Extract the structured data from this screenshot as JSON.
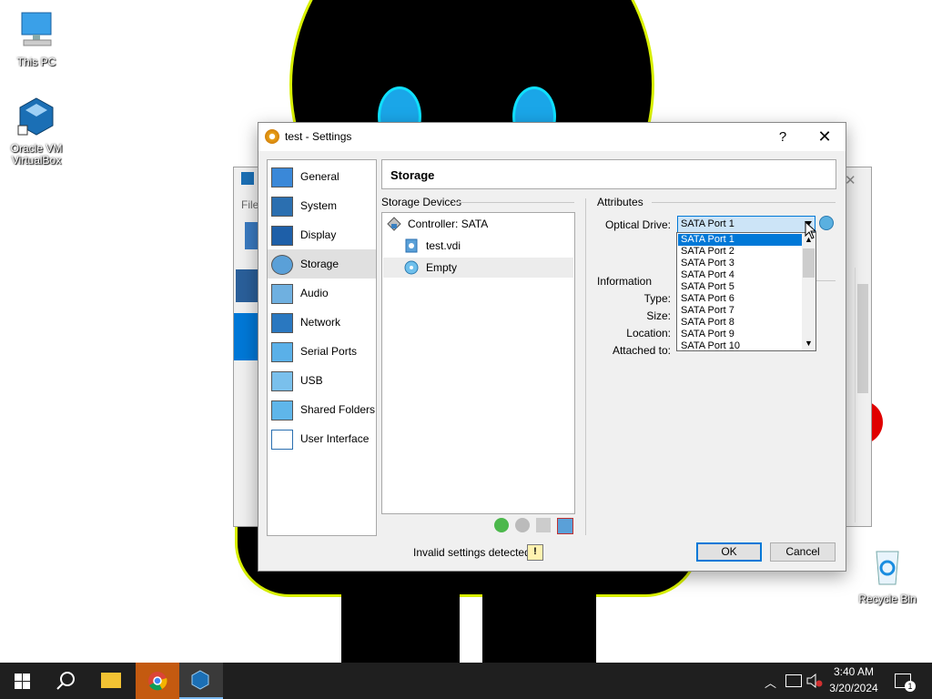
{
  "desktop": {
    "icons": [
      {
        "label": "This PC"
      },
      {
        "label": "Oracle VM\nVirtualBox"
      },
      {
        "label": "Recycle Bin"
      }
    ]
  },
  "background_window": {
    "menu_first": "File"
  },
  "dialog": {
    "title": "test - Settings",
    "help_label": "?",
    "close_label": "✕",
    "nav_items": [
      {
        "label": "General"
      },
      {
        "label": "System"
      },
      {
        "label": "Display"
      },
      {
        "label": "Storage"
      },
      {
        "label": "Audio"
      },
      {
        "label": "Network"
      },
      {
        "label": "Serial Ports"
      },
      {
        "label": "USB"
      },
      {
        "label": "Shared Folders"
      },
      {
        "label": "User Interface"
      }
    ],
    "selected_nav": "Storage",
    "header": "Storage",
    "storage_devices_label": "Storage Devices",
    "tree": {
      "controller": "Controller: SATA",
      "disk": "test.vdi",
      "optical": "Empty"
    },
    "attributes_label": "Attributes",
    "optical_drive_label": "Optical Drive:",
    "optical_drive_value": "SATA Port 1",
    "dropdown_options": [
      "SATA Port 1",
      "SATA Port 2",
      "SATA Port 3",
      "SATA Port 4",
      "SATA Port 5",
      "SATA Port 6",
      "SATA Port 7",
      "SATA Port 8",
      "SATA Port 9",
      "SATA Port 10"
    ],
    "information_label": "Information",
    "info_fields": [
      "Type:",
      "Size:",
      "Location:",
      "Attached to:"
    ],
    "invalid_text": "Invalid settings detected",
    "ok_label": "OK",
    "cancel_label": "Cancel"
  },
  "taskbar": {
    "time": "3:40 AM",
    "date": "3/20/2024",
    "notification_count": "1"
  }
}
